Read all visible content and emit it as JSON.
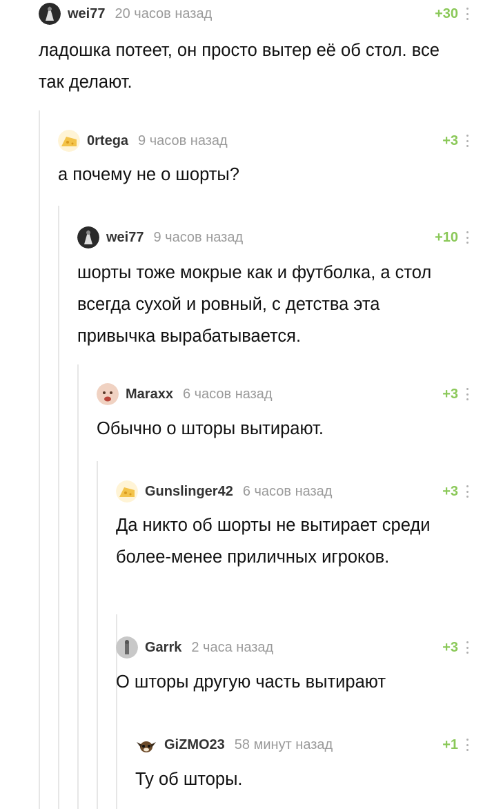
{
  "comments": [
    {
      "user": "wei77",
      "time": "20 часов назад",
      "rating": "+30",
      "text": "ладошка потеет, он просто вытер её об стол. все так делают.",
      "avatar": "dark-figure-avatar"
    },
    {
      "user": "0rtega",
      "time": "9 часов назад",
      "rating": "+3",
      "text": "а почему не о шорты?",
      "avatar": "cheese-avatar"
    },
    {
      "user": "wei77",
      "time": "9 часов назад",
      "rating": "+10",
      "text": "шорты тоже мокрые как и футболка, а стол всегда сухой и ровный, с детства эта привычка вырабатывается.",
      "avatar": "dark-figure-avatar"
    },
    {
      "user": "Maraxx",
      "time": "6 часов назад",
      "rating": "+3",
      "text": "Обычно о шторы вытирают.",
      "avatar": "baby-face-avatar"
    },
    {
      "user": "Gunslinger42",
      "time": "6 часов назад",
      "rating": "+3",
      "text": "Да никто об шорты не вытирает среди более-менее приличных игроков.",
      "avatar": "cheese-avatar"
    },
    {
      "user": "Garrk",
      "time": "2 часа назад",
      "rating": "+3",
      "text": "О шторы другую часть вытирают",
      "avatar": "gray-figure-avatar"
    },
    {
      "user": "GiZMO23",
      "time": "58 минут назад",
      "rating": "+1",
      "text": "Ту об шторы.",
      "avatar": "gizmo-avatar"
    }
  ],
  "colors": {
    "rating": "#8ac858",
    "time": "#9a9a9a",
    "thread_line": "#e6e6e6"
  }
}
